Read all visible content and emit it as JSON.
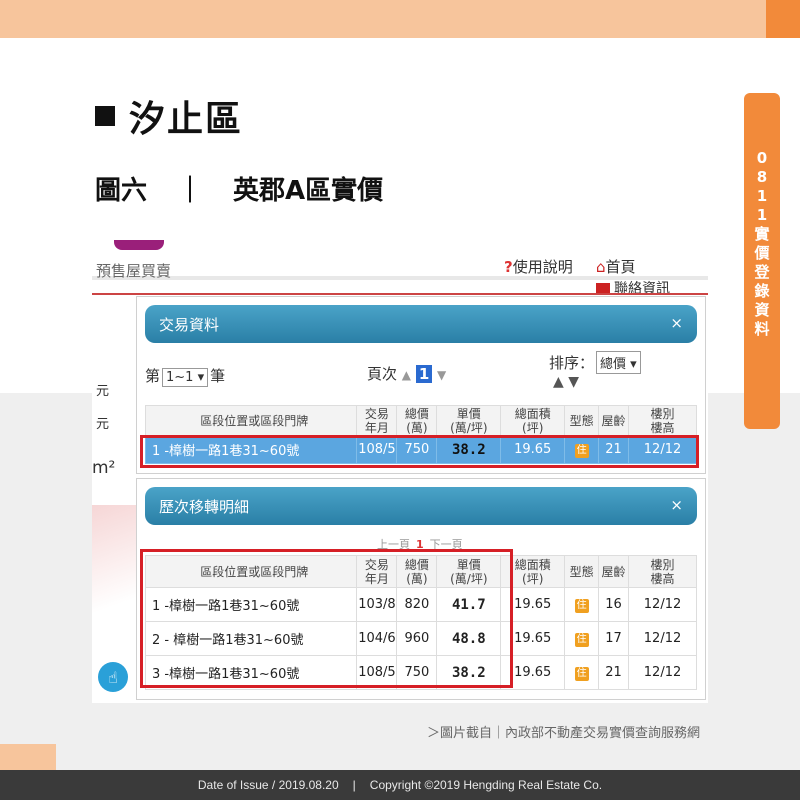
{
  "side_tab": [
    "0",
    "8",
    "1",
    "1",
    "實",
    "價",
    "登",
    "錄",
    "資",
    "料"
  ],
  "title": "汐止區",
  "subtitle": {
    "figure": "圖六",
    "sep": "｜",
    "name": "英郡A區實價"
  },
  "site": {
    "presale": "預售屋買賣",
    "help": "使用說明",
    "home": "首頁",
    "contact": "聯絡資訊",
    "left_labels": [
      "元",
      "元"
    ],
    "area_unit": "m²"
  },
  "transaction_panel": {
    "title": "交易資料",
    "close": "×",
    "count_prefix": "第",
    "count_value": "1~1",
    "count_suffix": "筆",
    "page_label": "頁次",
    "page_value": "1",
    "sort_label": "排序：",
    "sort_value": "總價",
    "headers": [
      "區段位置或區段門牌",
      "交易\n年月",
      "總價\n(萬)",
      "單價\n(萬/坪)",
      "總面積\n(坪)",
      "型態",
      "屋齡",
      "樓別\n樓高"
    ],
    "rows": [
      {
        "addr": "1 -樟樹一路1巷31~60號",
        "date": "108/5",
        "total": "750",
        "unit": "38.2",
        "area": "19.65",
        "type": "住",
        "age": "21",
        "floor": "12/12"
      }
    ]
  },
  "history_panel": {
    "title": "歷次移轉明細",
    "close": "×",
    "prev": "上一頁",
    "page": "1",
    "next": "下一頁",
    "headers": [
      "區段位置或區段門牌",
      "交易\n年月",
      "總價\n(萬)",
      "單價\n(萬/坪)",
      "總面積\n(坪)",
      "型態",
      "屋齡",
      "樓別\n樓高"
    ],
    "rows": [
      {
        "addr": "1 -樟樹一路1巷31~60號",
        "date": "103/8",
        "total": "820",
        "unit": "41.7",
        "area": "19.65",
        "type": "住",
        "age": "16",
        "floor": "12/12"
      },
      {
        "addr": "2 - 樟樹一路1巷31~60號",
        "date": "104/6",
        "total": "960",
        "unit": "48.8",
        "area": "19.65",
        "type": "住",
        "age": "17",
        "floor": "12/12"
      },
      {
        "addr": "3 -樟樹一路1巷31~60號",
        "date": "108/5",
        "total": "750",
        "unit": "38.2",
        "area": "19.65",
        "type": "住",
        "age": "21",
        "floor": "12/12"
      }
    ]
  },
  "source": "＞圖片截自｜內政部不動產交易實價查詢服務網",
  "footer": {
    "date": "Date of Issue / 2019.08.20",
    "sep": "|",
    "copyright": "Copyright ©2019 Hengding Real Estate Co."
  }
}
